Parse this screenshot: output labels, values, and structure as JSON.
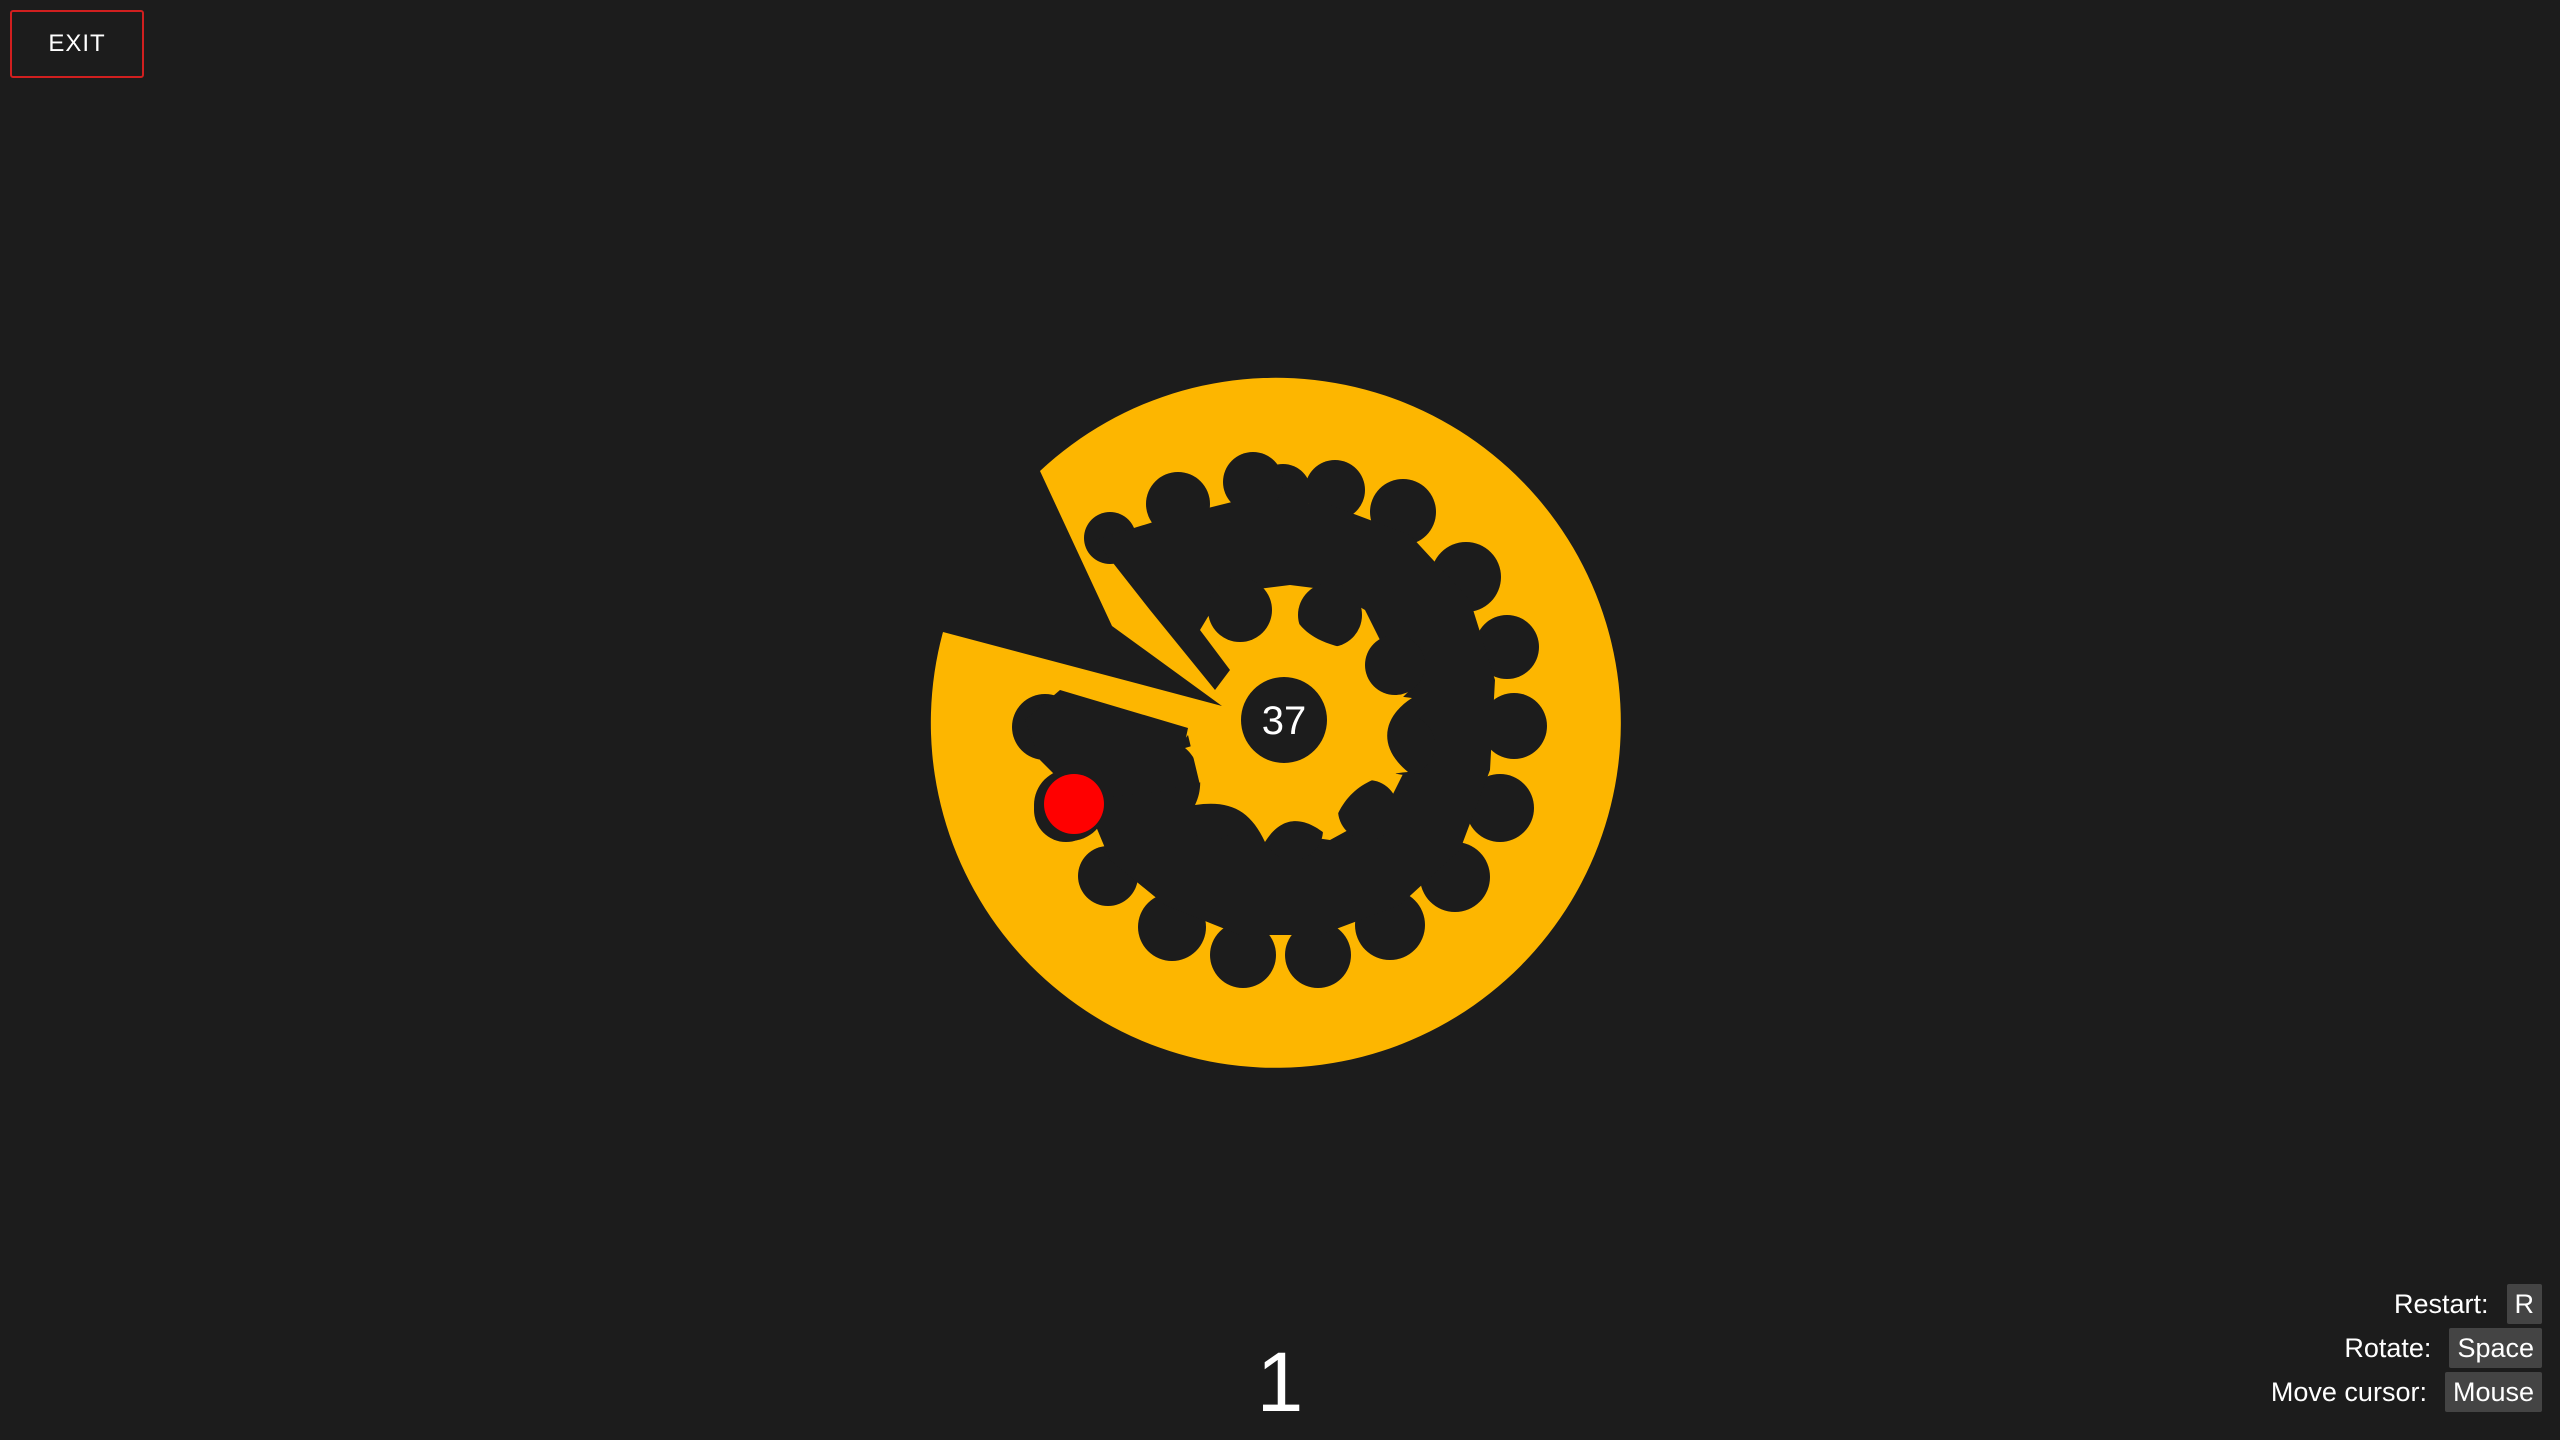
{
  "exit_label": "EXIT",
  "center_count": "37",
  "level": "1",
  "controls": [
    {
      "label": "Restart:",
      "key": "R"
    },
    {
      "label": "Rotate:",
      "key": "Space"
    },
    {
      "label": "Move cursor:",
      "key": "Mouse"
    }
  ],
  "colors": {
    "background": "#1c1c1c",
    "disc": "#fdb600",
    "ball": "#ff0000",
    "exit_border": "#d01f1f",
    "key_bg": "#444444"
  }
}
